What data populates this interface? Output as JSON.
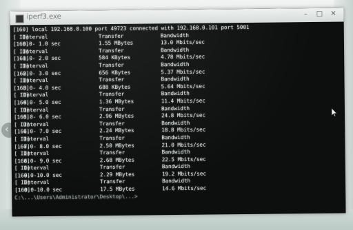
{
  "window": {
    "title": "iperf3.exe"
  },
  "console": {
    "connect_line": {
      "prefix": "[160] local 192.168.0.100 port 49723 connected with 192.168.0.101 port 5001"
    },
    "header": {
      "id": "[ ID]",
      "interval": "Interval",
      "transfer": "Transfer",
      "bandwidth": "Bandwidth"
    },
    "rows": [
      {
        "id": "[160]",
        "interval": "0.0- 1.0 sec",
        "transfer": "1.55 MBytes",
        "bandwidth": "13.0 Mbits/sec"
      },
      {
        "id": "[160]",
        "interval": "1.0- 2.0 sec",
        "transfer": "584 KBytes",
        "bandwidth": "4.78 Mbits/sec"
      },
      {
        "id": "[160]",
        "interval": "2.0- 3.0 sec",
        "transfer": "656 KBytes",
        "bandwidth": "5.37 Mbits/sec"
      },
      {
        "id": "[160]",
        "interval": "3.0- 4.0 sec",
        "transfer": "688 KBytes",
        "bandwidth": "5.64 Mbits/sec"
      },
      {
        "id": "[160]",
        "interval": "4.0- 5.0 sec",
        "transfer": "1.36 MBytes",
        "bandwidth": "11.4 Mbits/sec"
      },
      {
        "id": "[160]",
        "interval": "5.0- 6.0 sec",
        "transfer": "2.96 MBytes",
        "bandwidth": "24.8 Mbits/sec"
      },
      {
        "id": "[160]",
        "interval": "6.0- 7.0 sec",
        "transfer": "2.24 MBytes",
        "bandwidth": "18.8 Mbits/sec"
      },
      {
        "id": "[160]",
        "interval": "7.0- 8.0 sec",
        "transfer": "2.50 MBytes",
        "bandwidth": "21.0 Mbits/sec"
      },
      {
        "id": "[160]",
        "interval": "8.0- 9.0 sec",
        "transfer": "2.68 MBytes",
        "bandwidth": "22.5 Mbits/sec"
      },
      {
        "id": "[160]",
        "interval": "9.0-10.0 sec",
        "transfer": "2.29 MBytes",
        "bandwidth": "19.2 Mbits/sec"
      },
      {
        "id": "[160]",
        "interval": "0.0-10.0 sec",
        "transfer": "17.5 MBytes",
        "bandwidth": "14.6 Mbits/sec"
      }
    ],
    "prompt": "C:\\...\\Users\\Administrator\\Desktop\\...>"
  }
}
